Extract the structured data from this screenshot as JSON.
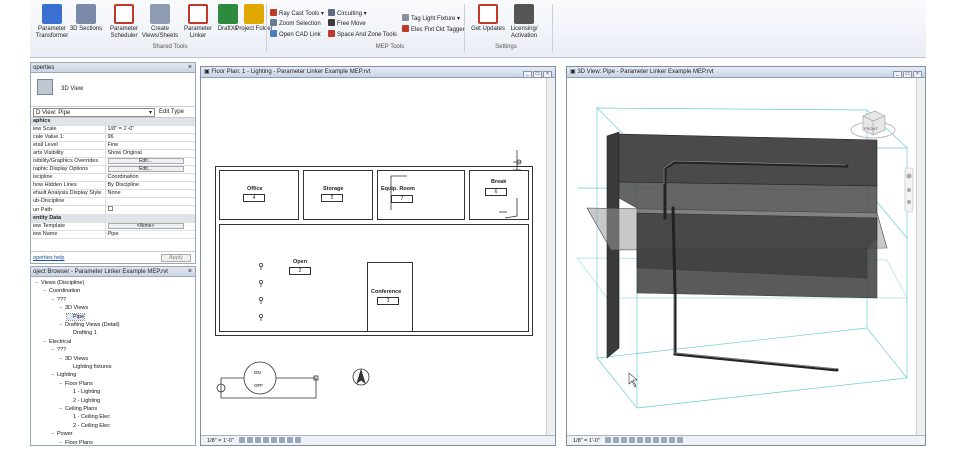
{
  "ribbon": {
    "buttons": [
      {
        "label": "Parameter Transformer",
        "color": "#3b6fd1"
      },
      {
        "label": "3D Sections",
        "color": "#7a8aa8"
      },
      {
        "label": "Parameter Scheduler",
        "color": "#c0392b"
      },
      {
        "label": "Create Views/Sheets",
        "color": "#8e9bb3"
      },
      {
        "label": "Parameter Linker",
        "color": "#c0392b"
      },
      {
        "label": "DraftXL",
        "color": "#2e8b3d"
      },
      {
        "label": "Project Folder",
        "color": "#e0a800"
      }
    ],
    "shared_tools_label": "Shared Tools",
    "mep_small": [
      "Ray Cast Tools",
      "Zoom Selection",
      "Open CAD Link",
      "Circuiting",
      "Free Move",
      "Space And Zone Tools",
      "Tag Light Fixture",
      "Elec Fixt Ckt Tagger"
    ],
    "mep_tools_label": "MEP Tools",
    "settings_buttons": [
      {
        "label": "Get Updates",
        "color": "#c0392b"
      },
      {
        "label": "Licensing/ Activation",
        "color": "#555555"
      }
    ],
    "settings_label": "Settings"
  },
  "properties": {
    "title": "operties",
    "type_label": "3D View",
    "filter": "D View: Pipe",
    "edit_type": "Edit Type",
    "rows": [
      {
        "k": "aphics",
        "v": "",
        "section": true
      },
      {
        "k": "iew Scale",
        "v": "1/8\" = 1'-0\""
      },
      {
        "k": "cale Value  1:",
        "v": "96"
      },
      {
        "k": "etail Level",
        "v": "Fine"
      },
      {
        "k": "arts Visibility",
        "v": "Show Original"
      },
      {
        "k": "isibility/Graphics Overrides",
        "v": "Edit...",
        "button": true
      },
      {
        "k": "raphic Display Options",
        "v": "Edit...",
        "button": true
      },
      {
        "k": "iscipline",
        "v": "Coordination"
      },
      {
        "k": "how Hidden Lines",
        "v": "By Discipline"
      },
      {
        "k": "efault Analysis Display Style",
        "v": "None"
      },
      {
        "k": "ub-Discipline",
        "v": ""
      },
      {
        "k": "un Path",
        "v": "",
        "check": true
      },
      {
        "k": "entity Data",
        "v": "",
        "section": true
      },
      {
        "k": "iew Template",
        "v": "<None>",
        "button": true
      },
      {
        "k": "iew Name",
        "v": "Pipe"
      }
    ],
    "help_link": "operties help",
    "apply": "Apply"
  },
  "browser": {
    "title": "oject Browser - Parameter Linker Example MEP.rvt",
    "items": [
      {
        "label": "Views (Discipline)",
        "toggle": "−",
        "indent": 0
      },
      {
        "label": "Coordination",
        "toggle": "−",
        "indent": 1
      },
      {
        "label": "???",
        "toggle": "−",
        "indent": 2
      },
      {
        "label": "3D Views",
        "toggle": "−",
        "indent": 3
      },
      {
        "label": "Pipe",
        "toggle": "",
        "indent": 4,
        "selected": true
      },
      {
        "label": "Drafting Views (Detail)",
        "toggle": "−",
        "indent": 3
      },
      {
        "label": "Drafting 1",
        "toggle": "",
        "indent": 4
      },
      {
        "label": "Electrical",
        "toggle": "−",
        "indent": 1
      },
      {
        "label": "???",
        "toggle": "−",
        "indent": 2
      },
      {
        "label": "3D Views",
        "toggle": "−",
        "indent": 3
      },
      {
        "label": "Lighting fixtures",
        "toggle": "",
        "indent": 4
      },
      {
        "label": "Lighting",
        "toggle": "−",
        "indent": 2
      },
      {
        "label": "Floor Plans",
        "toggle": "−",
        "indent": 3
      },
      {
        "label": "1 - Lighting",
        "toggle": "",
        "indent": 4
      },
      {
        "label": "2 - Lighting",
        "toggle": "",
        "indent": 4
      },
      {
        "label": "Ceiling Plans",
        "toggle": "−",
        "indent": 3
      },
      {
        "label": "1 - Ceiling Elec",
        "toggle": "",
        "indent": 4
      },
      {
        "label": "2 - Ceiling Elec",
        "toggle": "",
        "indent": 4
      },
      {
        "label": "Power",
        "toggle": "−",
        "indent": 2
      },
      {
        "label": "Floor Plans",
        "toggle": "−",
        "indent": 3
      }
    ]
  },
  "floor_view": {
    "title": "Floor Plan: 1 - Lighting - Parameter Linker Example MEP.rvt",
    "scale": "1/8\" = 1'-0\"",
    "rooms": [
      {
        "name": "Office",
        "number": "4"
      },
      {
        "name": "Storage",
        "number": "5"
      },
      {
        "name": "Equip. Room",
        "number": "7"
      },
      {
        "name": "Break",
        "number": "6"
      },
      {
        "name": "Open",
        "number": "2"
      },
      {
        "name": "Conference",
        "number": "3"
      }
    ],
    "switch_on": "ON",
    "switch_off": "OFF"
  },
  "view3d": {
    "title": "3D View: Pipe - Parameter Linker Example MEP.rvt",
    "scale": "1/8\" = 1'-0\"",
    "viewcube_label": "FRONT"
  },
  "colors": {
    "accent": "#3b6fd1",
    "wall": "#3a3a3a",
    "section_box": "#6ec9d8"
  }
}
